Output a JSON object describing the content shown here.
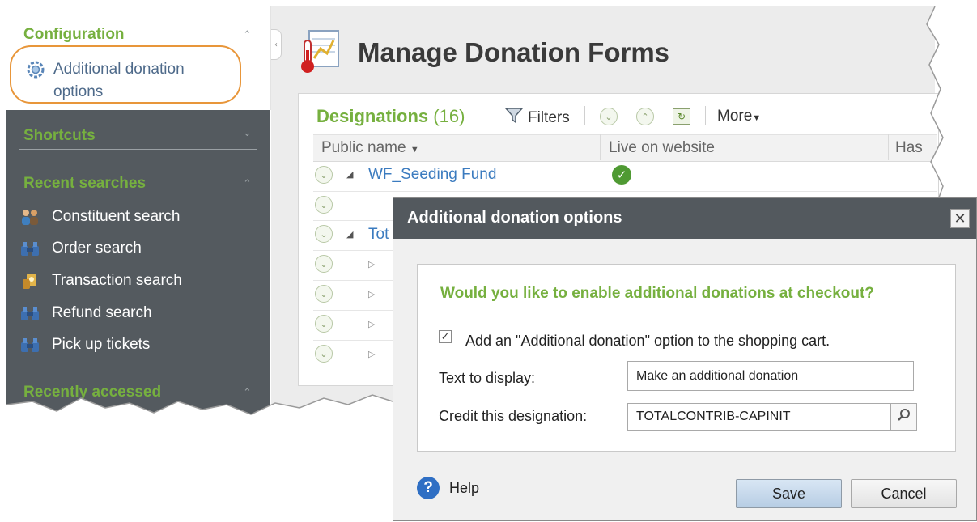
{
  "sidebar": {
    "configuration": {
      "title": "Configuration",
      "item": "Additional donation options",
      "item_line1": "Additional donation",
      "item_line2": "options"
    },
    "shortcuts": {
      "title": "Shortcuts"
    },
    "recent_searches": {
      "title": "Recent searches",
      "items": [
        {
          "label": "Constituent search",
          "icon": "people-icon"
        },
        {
          "label": "Order search",
          "icon": "binoculars-icon"
        },
        {
          "label": "Transaction search",
          "icon": "transaction-icon"
        },
        {
          "label": "Refund search",
          "icon": "binoculars-icon"
        },
        {
          "label": "Pick up tickets",
          "icon": "binoculars-icon"
        }
      ]
    },
    "recently_accessed": {
      "title": "Recently accessed"
    }
  },
  "main": {
    "title": "Manage Donation Forms",
    "designations": {
      "title": "Designations",
      "count": "(16)",
      "filters_label": "Filters",
      "more_label": "More",
      "columns": [
        "Public name",
        "Live on website",
        "Has"
      ],
      "rows": [
        {
          "name": "WF_Seeding Fund",
          "live": true
        },
        {
          "name": "",
          "live": false
        },
        {
          "name": "Tot",
          "live": false
        }
      ]
    }
  },
  "dialog": {
    "title": "Additional donation options",
    "question": "Would you like to enable additional donations at checkout?",
    "checkbox_label": "Add an \"Additional donation\" option to the shopping cart.",
    "checkbox_checked": true,
    "text_label": "Text to display:",
    "text_value": "Make an additional donation",
    "credit_label": "Credit this designation:",
    "credit_value": "TOTALCONTRIB-CAPINIT",
    "help_label": "Help",
    "save_label": "Save",
    "cancel_label": "Cancel"
  },
  "colors": {
    "accent_green": "#76b03f",
    "dark_panel": "#545a5f",
    "highlight_orange": "#e8963a"
  }
}
